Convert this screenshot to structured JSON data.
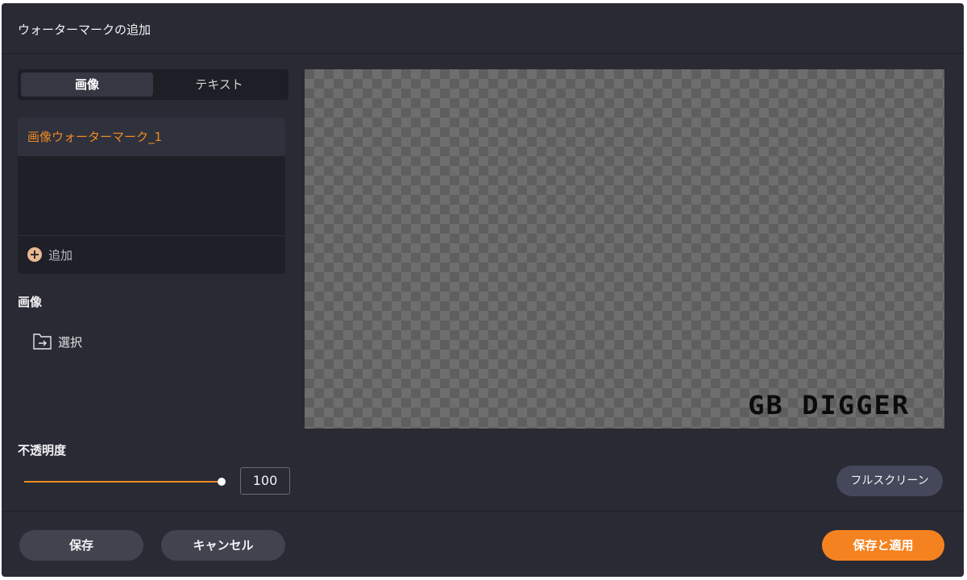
{
  "window": {
    "title": "ウォーターマークの追加"
  },
  "tabs": {
    "image_label": "画像",
    "text_label": "テキスト",
    "selected": "画像"
  },
  "watermark_list": {
    "items": [
      {
        "label": "画像ウォーターマーク_1",
        "selected": true
      }
    ],
    "add_label": "追加"
  },
  "image_section": {
    "heading": "画像",
    "select_label": "選択"
  },
  "opacity": {
    "heading": "不透明度",
    "value": "100",
    "fraction": 1.0
  },
  "preview": {
    "watermark_text": "GB DIGGER",
    "fullscreen_label": "フルスクリーン"
  },
  "footer": {
    "save_label": "保存",
    "cancel_label": "キャンセル",
    "apply_label": "保存と適用"
  },
  "colors": {
    "accent": "#f58220",
    "background": "#292a33",
    "selected_item_text": "#f08a24"
  },
  "icons": {
    "add": "plus-circle-icon",
    "select": "folder-arrow-icon"
  }
}
